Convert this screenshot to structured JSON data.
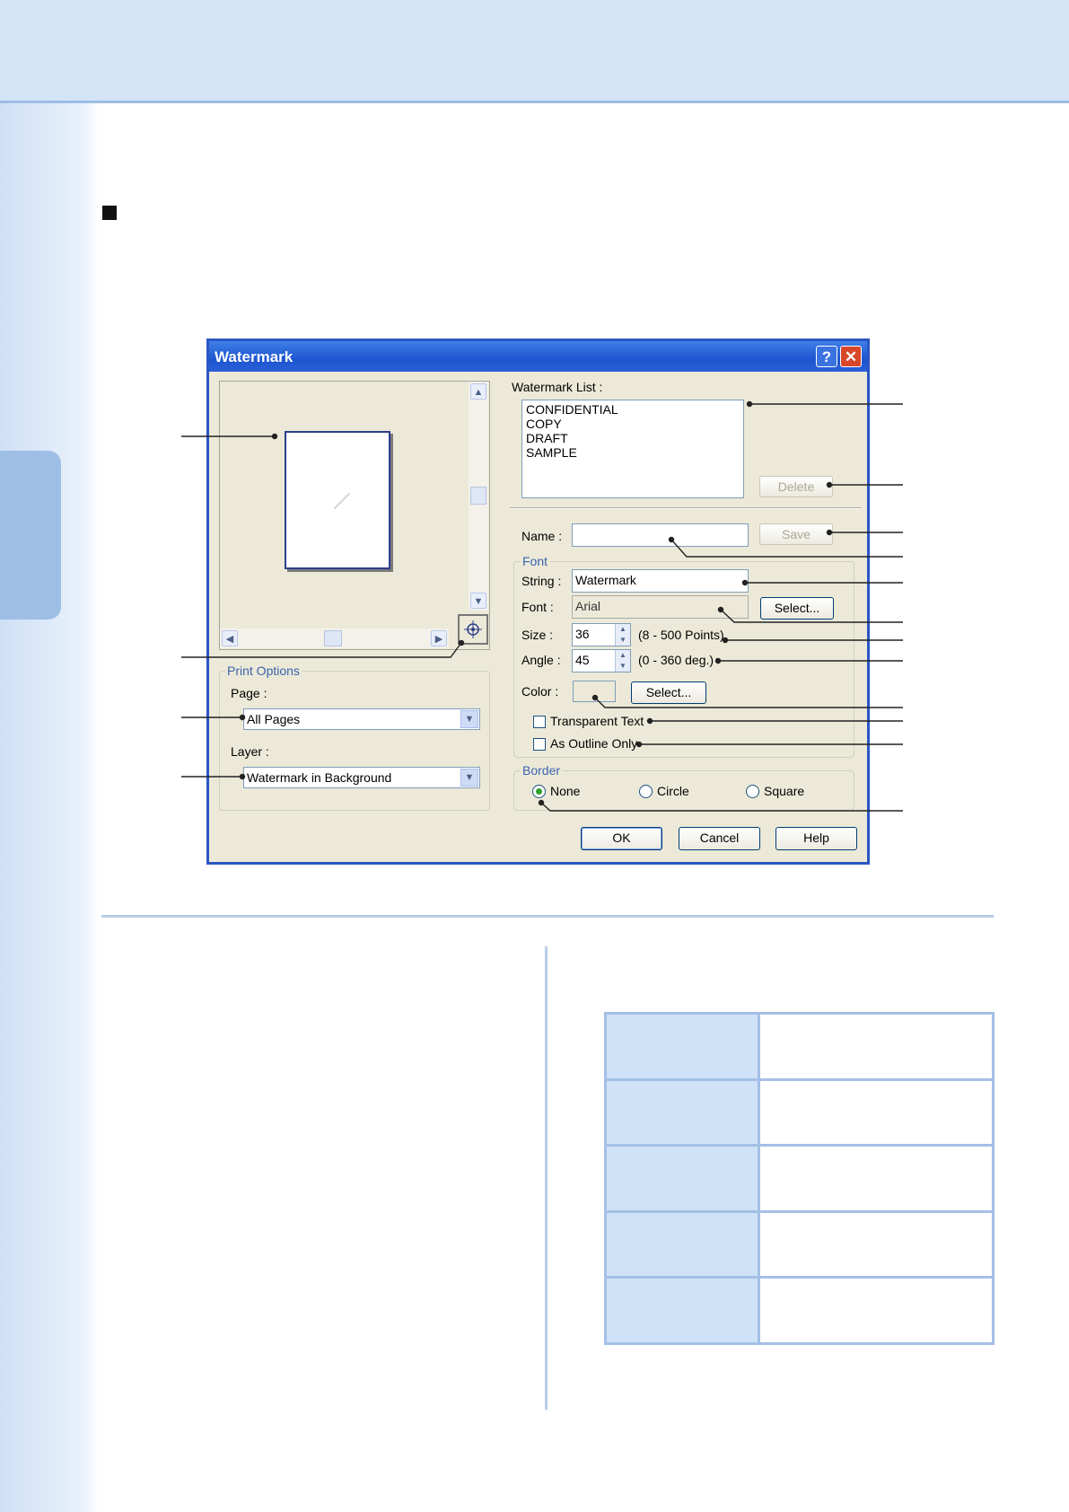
{
  "dialog": {
    "title": "Watermark",
    "help_glyph": "?",
    "close_glyph": "✕",
    "watermark_list": {
      "label": "Watermark List :",
      "items": [
        "CONFIDENTIAL",
        "COPY",
        "DRAFT",
        "SAMPLE"
      ]
    },
    "delete_label": "Delete",
    "name": {
      "label": "Name :",
      "value": ""
    },
    "save_label": "Save",
    "font_group": {
      "label": "Font",
      "string_label": "String :",
      "string_value": "Watermark",
      "font_label": "Font :",
      "font_value": "Arial",
      "font_select_label": "Select...",
      "size_label": "Size :",
      "size_value": "36",
      "size_range": "(8 - 500 Points)",
      "angle_label": "Angle :",
      "angle_value": "45",
      "angle_range": "(0 - 360 deg.)",
      "color_label": "Color :",
      "color_select_label": "Select...",
      "transparent_label": "Transparent Text",
      "outline_label": "As Outline Only"
    },
    "border_group": {
      "label": "Border",
      "options": [
        "None",
        "Circle",
        "Square"
      ],
      "selected": "None"
    },
    "print_options": {
      "label": "Print Options",
      "page_label": "Page :",
      "page_value": "All Pages",
      "layer_label": "Layer :",
      "layer_value": "Watermark in Background"
    },
    "ok_label": "OK",
    "cancel_label": "Cancel",
    "help_label": "Help"
  },
  "colors": {
    "titlebar": "#2a5fd6",
    "dialog_bg": "#ece9d8",
    "accent_band": "#d4e4f7",
    "table_header": "#d0e2f7",
    "table_border": "#a3c0e6"
  },
  "icons": [
    "help-icon",
    "close-icon",
    "chevron-up-icon",
    "chevron-down-icon",
    "chevron-left-icon",
    "chevron-right-icon",
    "target-icon"
  ]
}
